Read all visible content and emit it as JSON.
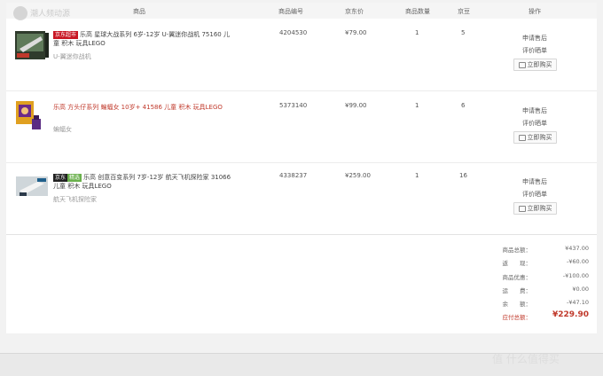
{
  "watermark_top": "潮人频动源",
  "table": {
    "headers": {
      "product": "商品",
      "sku": "商品编号",
      "price": "京东价",
      "qty": "商品数量",
      "beans": "京豆",
      "action": "操作"
    }
  },
  "items": [
    {
      "badge": "京东超市",
      "name": "乐高 星球大战系列 6岁-12岁 U-翼迷你战机 75160 儿童 积木 玩具LEGO",
      "spec": "U-翼迷你战机",
      "sku": "4204530",
      "price": "¥79.00",
      "qty": "1",
      "beans": "5",
      "after_sale": "申请售后",
      "review": "评价晒单",
      "buy": "立即购买"
    },
    {
      "name": "乐高 方头仔系列 蝙蝠女 10岁+ 41586 儿童 积木 玩具LEGO",
      "spec": "蝙蝠女",
      "sku": "5373140",
      "price": "¥99.00",
      "qty": "1",
      "beans": "6",
      "after_sale": "申请售后",
      "review": "评价晒单",
      "buy": "立即购买"
    },
    {
      "badge_a": "京东",
      "badge_b": "精选",
      "name": "乐高 创意百变系列 7岁-12岁 航天飞机探险家 31066 儿童 积木 玩具LEGO",
      "spec": "航天飞机探险家",
      "sku": "4338237",
      "price": "¥259.00",
      "qty": "1",
      "beans": "16",
      "after_sale": "申请售后",
      "review": "评价晒单",
      "buy": "立即购买"
    }
  ],
  "summary": {
    "goods_total_label": "商品总额：",
    "goods_total": "¥437.00",
    "rebate_label": "返　　现：",
    "rebate": "-¥60.00",
    "discount_label": "商品优惠：",
    "discount": "-¥100.00",
    "shipping_label": "运　　费：",
    "shipping": "¥0.00",
    "balance_label": "余　　额：",
    "balance": "-¥47.10",
    "payable_label": "应付总额：",
    "payable": "¥229.90"
  },
  "watermark_bottom": "值 什么值得买"
}
